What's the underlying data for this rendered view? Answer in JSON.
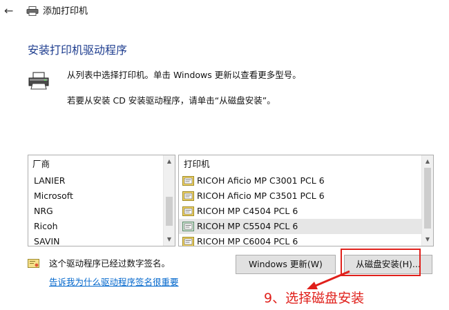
{
  "window": {
    "back_icon": "back-arrow-icon",
    "title_icon": "printer-icon",
    "title": "添加打印机"
  },
  "page": {
    "heading": "安装打印机驱动程序",
    "info_icon": "printer-icon",
    "info_line1": "从列表中选择打印机。单击 Windows 更新以查看更多型号。",
    "info_line2": "若要从安装 CD 安装驱动程序，请单击“从磁盘安装”。"
  },
  "manufacturer_list": {
    "header": "厂商",
    "items": [
      "LANIER",
      "Microsoft",
      "NRG",
      "Ricoh",
      "SAVIN"
    ],
    "selected": "Ricoh"
  },
  "printer_list": {
    "header": "打印机",
    "items": [
      {
        "label": "RICOH Aficio MP C3001 PCL 6",
        "icon": "printer-driver-icon"
      },
      {
        "label": "RICOH Aficio MP C3501 PCL 6",
        "icon": "printer-driver-icon"
      },
      {
        "label": "RICOH MP C4504 PCL 6",
        "icon": "printer-driver-icon"
      },
      {
        "label": "RICOH MP C5504 PCL 6",
        "icon": "printer-driver-icon"
      },
      {
        "label": "RICOH MP C6004 PCL 6",
        "icon": "printer-driver-icon"
      }
    ],
    "selected": "RICOH MP C5504 PCL 6"
  },
  "signature": {
    "icon": "certificate-icon",
    "text": "这个驱动程序已经过数字签名。",
    "link": "告诉我为什么驱动程序签名很重要"
  },
  "buttons": {
    "windows_update": "Windows 更新(W)",
    "have_disk": "从磁盘安装(H)..."
  },
  "annotation": {
    "text": "9、选择磁盘安装",
    "color": "#e0201b"
  },
  "colors": {
    "heading": "#1e3d8f",
    "link": "#0066cc",
    "selection": "#e6e6e6"
  }
}
